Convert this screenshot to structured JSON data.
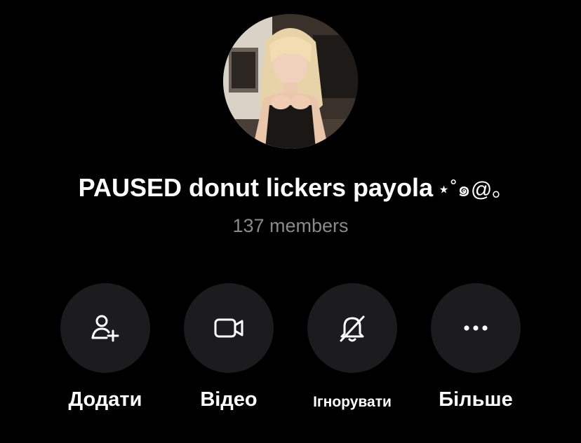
{
  "group": {
    "name": "PAUSED donut lickers payola",
    "name_decoration": "⋆˚๑@｡",
    "member_count": "137 members"
  },
  "actions": [
    {
      "label": "Додати",
      "icon": "add-user-icon"
    },
    {
      "label": "Відео",
      "icon": "video-camera-icon"
    },
    {
      "label": "Ігнорувати",
      "icon": "bell-slash-icon"
    },
    {
      "label": "Більше",
      "icon": "more-dots-icon"
    }
  ],
  "colors": {
    "background": "#000000",
    "button_background": "#1c1c1e",
    "primary_text": "#ffffff",
    "secondary_text": "#8a8a8e"
  }
}
